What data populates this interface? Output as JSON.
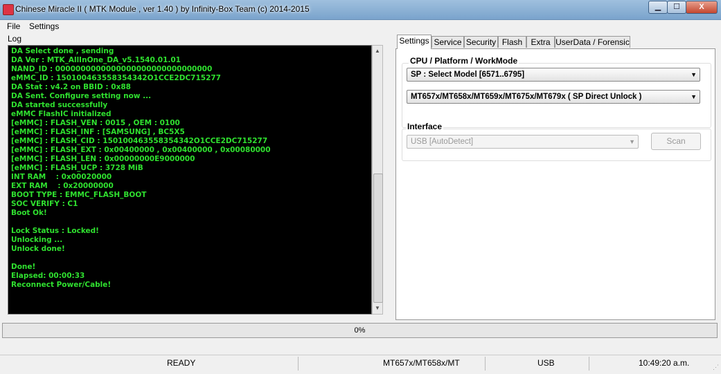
{
  "window": {
    "title": "Chinese Miracle II ( MTK Module , ver 1.40 ) by Infinity-Box Team (c) 2014-2015",
    "minimize": "▁",
    "maximize": "☐",
    "close": "X"
  },
  "menu": {
    "file": "File",
    "settings": "Settings"
  },
  "log": {
    "label": "Log",
    "lines": [
      "DA Select done , sending",
      "DA Ver : MTK_AllInOne_DA_v5.1540.01.01",
      "NAND_ID : 0000000000000000000000000000000",
      "eMMC_ID : 150100463558354342O1CCE2DC715277",
      "DA Stat : v4.2 on BBID : 0x88",
      "DA Sent. Configure setting now ...",
      "DA started successfully",
      "eMMC FlashIC initialized",
      "[eMMC] : FLASH_VEN : 0015 , OEM : 0100",
      "[eMMC] : FLASH_INF : [SAMSUNG] , BC5X5",
      "[eMMC] : FLASH_CID : 150100463558354342O1CCE2DC715277",
      "[eMMC] : FLASH_EXT : 0x00400000 , 0x00400000 , 0x00080000",
      "[eMMC] : FLASH_LEN : 0x00000000E9000000",
      "[eMMC] : FLASH_UCP : 3728 MiB",
      "INT RAM    : 0x00020000",
      "EXT RAM    : 0x20000000",
      "BOOT TYPE : EMMC_FLASH_BOOT",
      "SOC VERIFY : C1",
      "Boot Ok!",
      "",
      "Lock Status : Locked!",
      "Unlocking ...",
      "Unlock done!",
      "",
      "Done!",
      "Elapsed: 00:00:33",
      "Reconnect Power/Cable!"
    ]
  },
  "tabs": [
    "Settings",
    "Service",
    "Security",
    "Flash",
    "Extra",
    "UserData / Forensic"
  ],
  "settings": {
    "cpu_label": "CPU / Platform / WorkMode",
    "model_select": "SP : Select Model [6571..6795]",
    "mode_select": "MT657x/MT658x/MT659x/MT675x/MT679x   ( SP Direct Unlock )",
    "interface_label": "Interface",
    "interface_select": "USB [AutoDetect]",
    "scan_button": "Scan"
  },
  "progress": {
    "percent": 0,
    "text": "0%"
  },
  "status": {
    "state": "READY",
    "platform": "MT657x/MT658x/MT",
    "port": "USB",
    "time": "10:49:20 a.m."
  },
  "colors": {
    "log_text": "#2fe02f",
    "log_bg": "#000000"
  }
}
